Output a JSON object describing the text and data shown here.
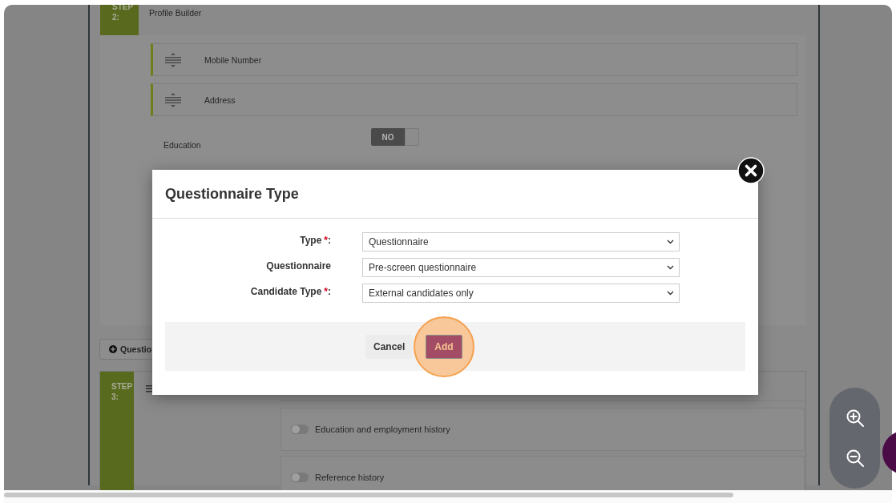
{
  "background_page": {
    "step_2": {
      "label": "STEP",
      "number": "2:",
      "title": "Profile Builder"
    },
    "fields": [
      {
        "kind": "draggable",
        "label": "Mobile Number"
      },
      {
        "kind": "draggable",
        "label": "Address"
      },
      {
        "kind": "toggle",
        "label": "Education",
        "on": false,
        "toggle_text": "NO"
      }
    ],
    "add_question_button": "Questio",
    "step_3": {
      "label": "STEP",
      "number": "3:"
    },
    "history_options": [
      {
        "label": "Education and employment history",
        "on": false
      },
      {
        "label": "Reference history",
        "on": false
      }
    ]
  },
  "modal": {
    "title": "Questionnaire Type",
    "fields": [
      {
        "label": "Type",
        "required_mark": "*",
        "colon": ":",
        "value": "Questionnaire"
      },
      {
        "label": "Questionnaire",
        "value": "Pre-screen questionnaire"
      },
      {
        "label": "Candidate Type",
        "required_mark": "*",
        "colon": ":",
        "value": "External candidates only"
      }
    ],
    "buttons": [
      {
        "kind": "secondary",
        "label": "Cancel",
        "highlighted": false
      },
      {
        "kind": "primary",
        "label": "Add",
        "highlighted": true
      }
    ]
  }
}
